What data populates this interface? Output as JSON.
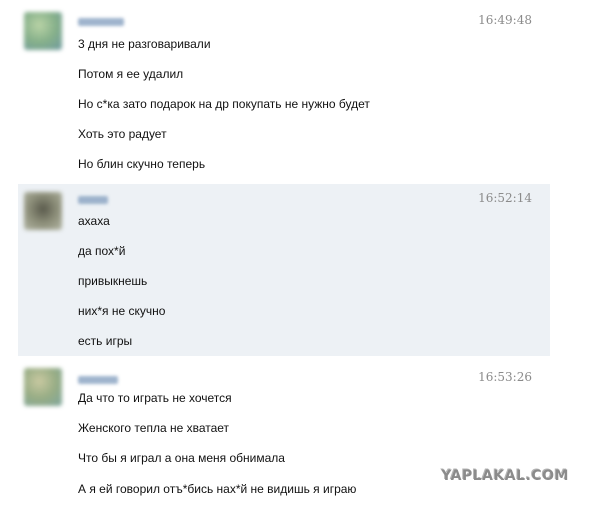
{
  "messages": [
    {
      "time": "16:49:48",
      "avatar": "user-photo-blurred",
      "lines": [
        "3 дня не разговаривали",
        "Потом я ее удалил",
        "Но с*ка зато подарок на др покупать не нужно будет",
        "Хоть это радует",
        "Но блин скучно теперь"
      ]
    },
    {
      "time": "16:52:14",
      "avatar": "user-photo-blurred",
      "lines": [
        "ахаха",
        "да пох*й",
        "привыкнешь",
        "них*я не скучно",
        "есть игры"
      ]
    },
    {
      "time": "16:53:26",
      "avatar": "user-photo-blurred",
      "lines": [
        "Да что то играть не хочется",
        "Женского тепла не хватает",
        "Что бы я играл а она меня обнимала",
        "А я ей говорил отъ*бись нах*й не видишь я играю"
      ]
    }
  ],
  "watermark": "YAPLAKAL.COM"
}
